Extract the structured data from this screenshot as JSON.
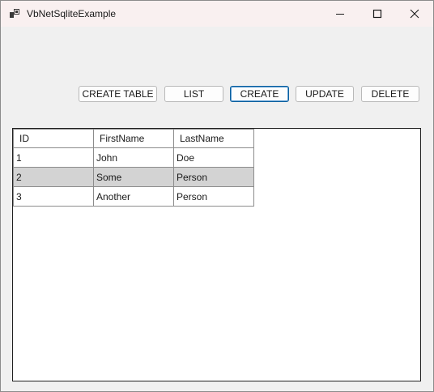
{
  "window": {
    "title": "VbNetSqliteExample"
  },
  "caption_buttons": {
    "minimize_icon": "minimize-icon",
    "maximize_icon": "maximize-icon",
    "close_icon": "close-icon"
  },
  "toolbar": {
    "create_table_label": "CREATE TABLE",
    "list_label": "LIST",
    "create_label": "CREATE",
    "update_label": "UPDATE",
    "delete_label": "DELETE"
  },
  "grid": {
    "columns": [
      "ID",
      "FirstName",
      "LastName"
    ],
    "rows": [
      {
        "id": "1",
        "first_name": "John",
        "last_name": "Doe",
        "selected": false
      },
      {
        "id": "2",
        "first_name": "Some",
        "last_name": "Person",
        "selected": true
      },
      {
        "id": "3",
        "first_name": "Another",
        "last_name": "Person",
        "selected": false
      }
    ]
  },
  "colors": {
    "title_bar": "#f9f0f0",
    "form_background": "#f0f0f0",
    "selected_row": "#d3d3d3",
    "focus_border": "#0a5f9e"
  }
}
